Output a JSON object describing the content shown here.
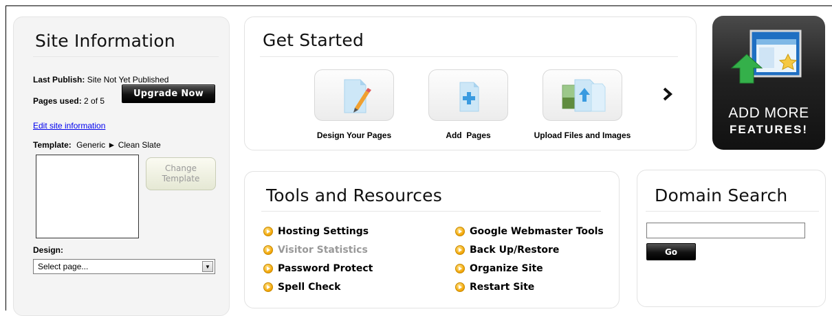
{
  "site_info": {
    "title": "Site Information",
    "last_publish_label": "Last Publish:",
    "last_publish_value": "Site Not Yet Published",
    "pages_used_label": "Pages used:",
    "pages_used_value": "2 of 5",
    "upgrade_button": "Upgrade Now",
    "edit_link": "Edit site information",
    "template_label": "Template:",
    "template_value": "Generic ► Clean Slate",
    "change_template_line1": "Change",
    "change_template_line2": "Template",
    "design_label": "Design:",
    "design_select_value": "Select page..."
  },
  "get_started": {
    "title": "Get Started",
    "tiles": [
      {
        "label": "Design Your Pages",
        "icon": "design-pages-icon"
      },
      {
        "label": "Add  Pages",
        "icon": "add-page-icon"
      },
      {
        "label": "Upload Files and Images",
        "icon": "upload-files-icon"
      }
    ],
    "next_icon": "chevron-right-icon"
  },
  "add_more": {
    "line1": "ADD MORE",
    "line2": "FEATURES!"
  },
  "tools": {
    "title": "Tools and Resources",
    "left": [
      {
        "label": "Hosting Settings",
        "enabled": true
      },
      {
        "label": "Visitor Statistics",
        "enabled": false
      },
      {
        "label": "Password Protect",
        "enabled": true
      },
      {
        "label": "Spell Check",
        "enabled": true
      }
    ],
    "right": [
      {
        "label": "Google Webmaster Tools",
        "enabled": true
      },
      {
        "label": "Back Up/Restore",
        "enabled": true
      },
      {
        "label": "Organize Site",
        "enabled": true
      },
      {
        "label": "Restart Site",
        "enabled": true
      }
    ]
  },
  "domain_search": {
    "title": "Domain Search",
    "input_value": "",
    "go_button": "Go"
  },
  "colors": {
    "link": "#0000ee",
    "bullet": "#f2a300",
    "dim_text": "#999999"
  }
}
